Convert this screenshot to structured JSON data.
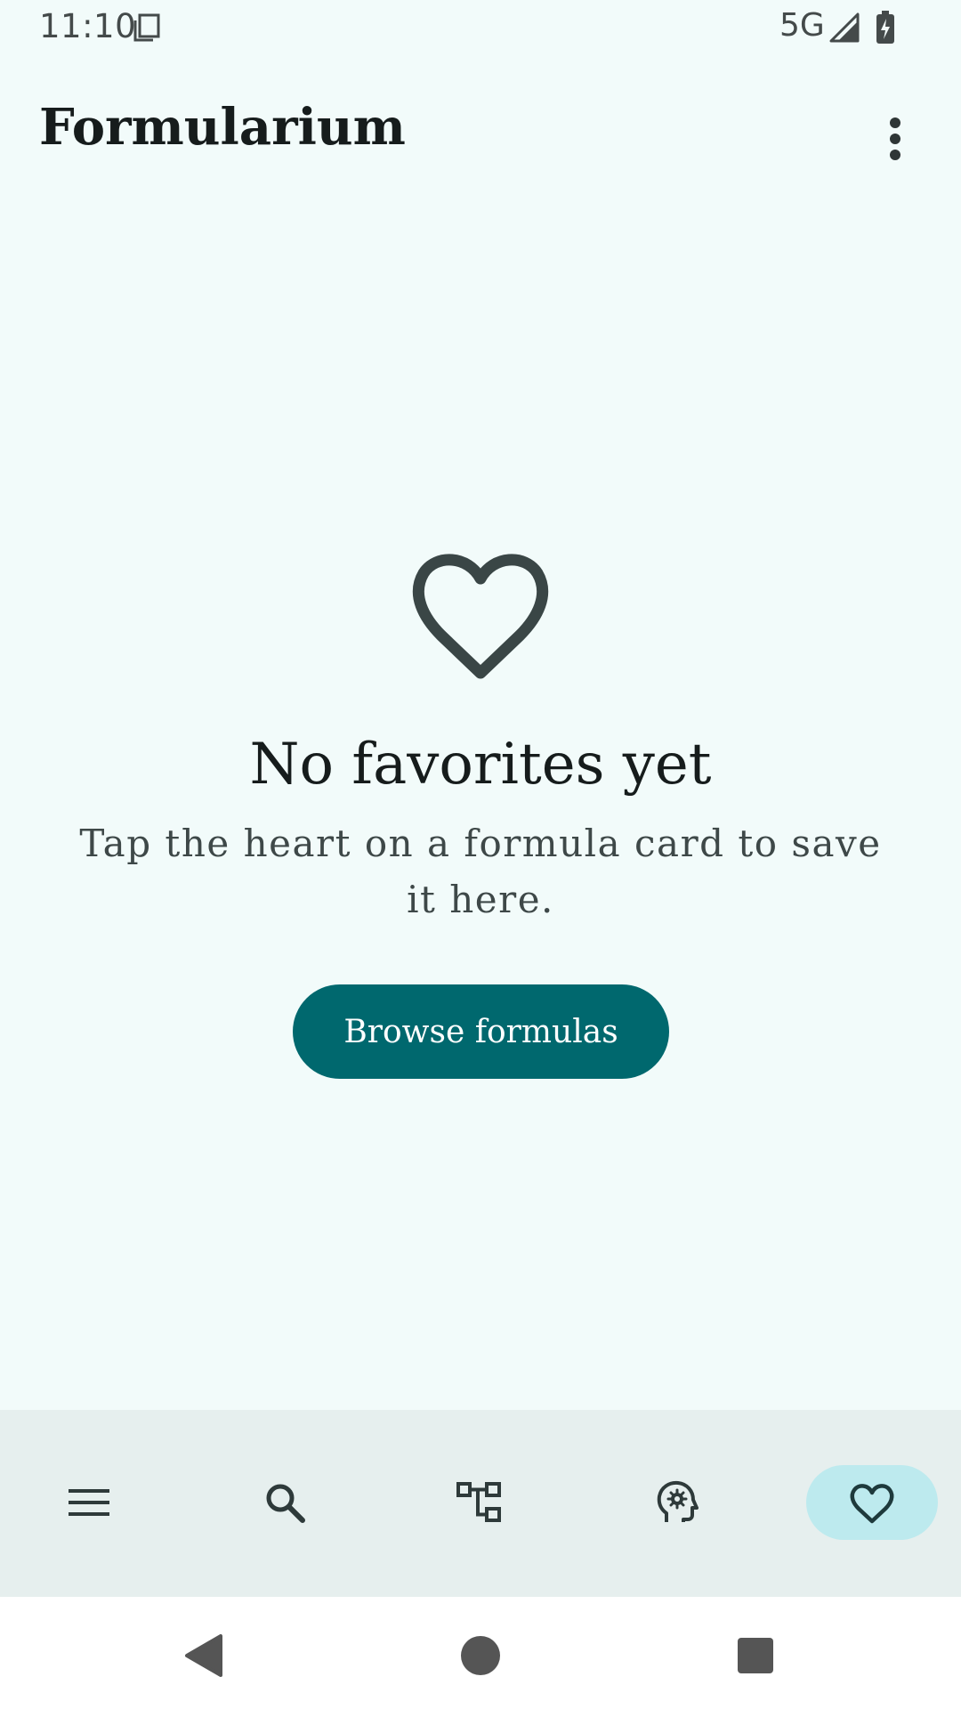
{
  "status_bar": {
    "time": "11:10",
    "network": "5G",
    "icons": [
      "notification-icon",
      "signal-icon",
      "battery-charging-icon"
    ]
  },
  "app_bar": {
    "title": "Formularium",
    "overflow_icon": "more-vert-icon"
  },
  "empty_state": {
    "icon": "heart-outline-icon",
    "title": "No favorites yet",
    "subtitle": "Tap the heart on a formula card to save it here.",
    "button_label": "Browse formulas"
  },
  "bottom_nav": {
    "items": [
      {
        "icon": "menu-icon",
        "active": false
      },
      {
        "icon": "search-icon",
        "active": false
      },
      {
        "icon": "hierarchy-icon",
        "active": false
      },
      {
        "icon": "head-gear-icon",
        "active": false
      },
      {
        "icon": "heart-icon",
        "active": true
      }
    ]
  },
  "system_nav": {
    "icons": [
      "back-icon",
      "home-icon",
      "recents-icon"
    ]
  },
  "colors": {
    "background": "#f2fbfa",
    "primary": "#00686e",
    "nav_background": "#e6efee",
    "nav_active_indicator": "#bdeaee",
    "icon": "#3a4646"
  }
}
